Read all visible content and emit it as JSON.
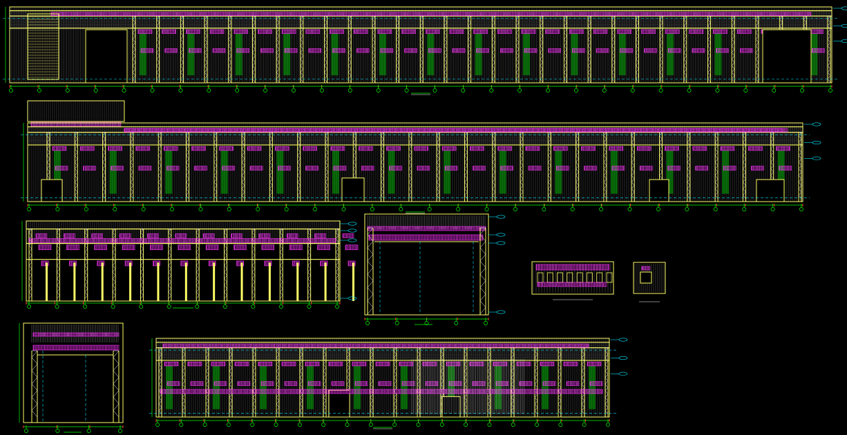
{
  "colors": {
    "background": "#000000",
    "structure": "#ffff66",
    "grid": "#ffffff",
    "axis": "#00ff00",
    "dimension": "#00e5ff",
    "annotation": "#ff33ff",
    "bracing": "#00cc00",
    "marker": "#ff3333"
  },
  "drawings": [
    {
      "id": "elevation-1",
      "kind": "long-elevation"
    },
    {
      "id": "elevation-2",
      "kind": "long-elevation"
    },
    {
      "id": "elevation-3",
      "kind": "medium-elevation"
    },
    {
      "id": "section-1",
      "kind": "portal-section"
    },
    {
      "id": "detail-1",
      "kind": "small-detail"
    },
    {
      "id": "detail-2",
      "kind": "small-detail"
    },
    {
      "id": "section-2",
      "kind": "portal-section"
    },
    {
      "id": "elevation-4",
      "kind": "long-elevation"
    }
  ]
}
